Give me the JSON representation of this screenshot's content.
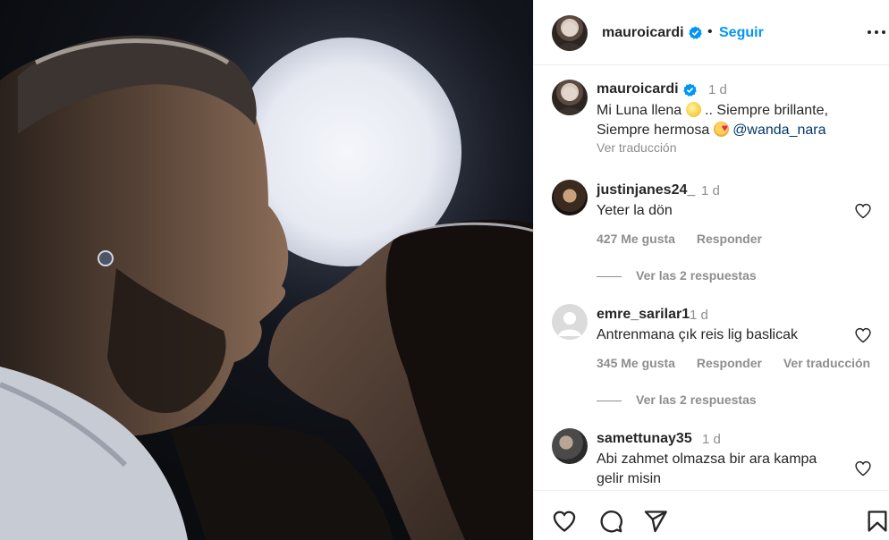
{
  "post": {
    "username": "mauroicardi",
    "follow_label": "Seguir",
    "dot": "•"
  },
  "caption": {
    "username": "mauroicardi",
    "time": "1 d",
    "text_1": "Mi Luna llena",
    "text_2": ".. Siempre brillante, Siempre hermosa",
    "mention": "@wanda_nara",
    "translate": "Ver traducción"
  },
  "comments": [
    {
      "username": "justinjanes24_",
      "time": "1 d",
      "text": "Yeter la dön",
      "likes": "427 Me gusta",
      "reply": "Responder",
      "replies": "Ver las 2 respuestas"
    },
    {
      "username": "emre_sarilar1",
      "time": "1 d",
      "text": "Antrenmana çık reis lig baslicak",
      "likes": "345 Me gusta",
      "reply": "Responder",
      "translate": "Ver traducción",
      "replies": "Ver las 2 respuestas"
    },
    {
      "username": "samettunay35",
      "time": "1 d",
      "text": "Abi zahmet olmazsa bir ara kampa gelir misin"
    }
  ],
  "icons": {
    "like": "heart-icon",
    "comment": "comment-icon",
    "share": "share-icon",
    "save": "bookmark-icon",
    "more": "more-options-icon",
    "verified": "verified-badge-icon"
  },
  "colors": {
    "link_blue": "#0095f6",
    "mention": "#00376b",
    "secondary_text": "#8e8e8e",
    "verified": "#0095f6"
  }
}
